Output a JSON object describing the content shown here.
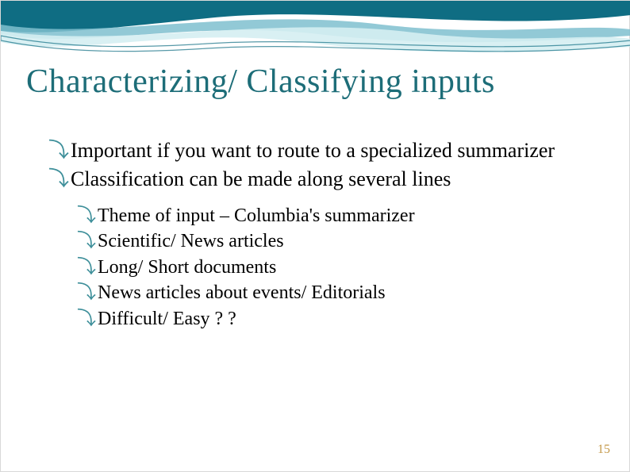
{
  "slide": {
    "title": "Characterizing/ Classifying inputs",
    "main_bullets": [
      "Important if you want to route to a specialized summarizer",
      "Classification can be made along several lines"
    ],
    "sub_bullets": [
      "Theme of input – Columbia's summarizer",
      "Scientific/ News articles",
      "Long/ Short documents",
      "News articles about events/ Editorials",
      "Difficult/ Easy ? ?"
    ],
    "page_number": "15"
  },
  "colors": {
    "title": "#1d6d78",
    "bullet_glyph": "#3e8f9a",
    "page_num": "#c59a4b",
    "wave_dark": "#0f6d83",
    "wave_mid": "#7fbfcf",
    "wave_light": "#d5eef2"
  }
}
